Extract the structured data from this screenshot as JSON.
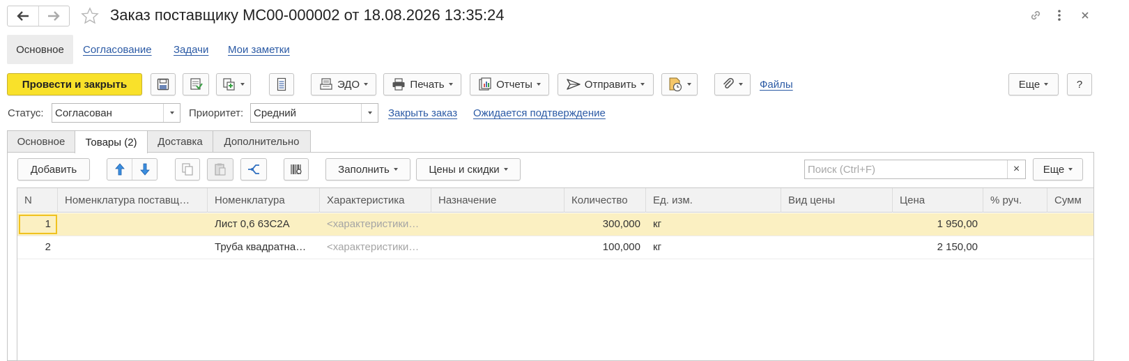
{
  "window": {
    "title": "Заказ поставщику МС00-000002 от 18.08.2026 13:35:24"
  },
  "nav": {
    "active": "Основное",
    "links": [
      "Согласование",
      "Задачи",
      "Мои заметки"
    ]
  },
  "toolbar": {
    "post_close": "Провести и закрыть",
    "edo": "ЭДО",
    "print": "Печать",
    "reports": "Отчеты",
    "send": "Отправить",
    "files": "Файлы",
    "more": "Еще",
    "help": "?"
  },
  "status_row": {
    "status_label": "Статус:",
    "status_value": "Согласован",
    "priority_label": "Приоритет:",
    "priority_value": "Средний",
    "close_order": "Закрыть заказ",
    "awaiting": "Ожидается подтверждение"
  },
  "tabs": [
    "Основное",
    "Товары (2)",
    "Доставка",
    "Дополнительно"
  ],
  "goods_toolbar": {
    "add": "Добавить",
    "fill": "Заполнить",
    "prices": "Цены и скидки",
    "search_placeholder": "Поиск (Ctrl+F)",
    "clear": "×",
    "more": "Еще"
  },
  "table": {
    "columns": [
      "N",
      "Номенклатура поставщ…",
      "Номенклатура",
      "Характеристика",
      "Назначение",
      "Количество",
      "Ед. изм.",
      "Вид цены",
      "Цена",
      "% руч.",
      "Сумм"
    ],
    "rows": [
      {
        "n": "1",
        "supplier_item": "",
        "item": "Лист 0,6 63С2А",
        "characteristic": "<характеристики…",
        "purpose": "",
        "qty": "300,000",
        "unit": "кг",
        "price_type": "",
        "price": "1 950,00",
        "manual": ""
      },
      {
        "n": "2",
        "supplier_item": "",
        "item": "Труба квадратна…",
        "characteristic": "<характеристики…",
        "purpose": "",
        "qty": "100,000",
        "unit": "кг",
        "price_type": "",
        "price": "2 150,00",
        "manual": ""
      }
    ]
  },
  "colors": {
    "primary_button": "#f9e12a",
    "link": "#2b5aa5",
    "selected_row": "#fbf0c2"
  }
}
